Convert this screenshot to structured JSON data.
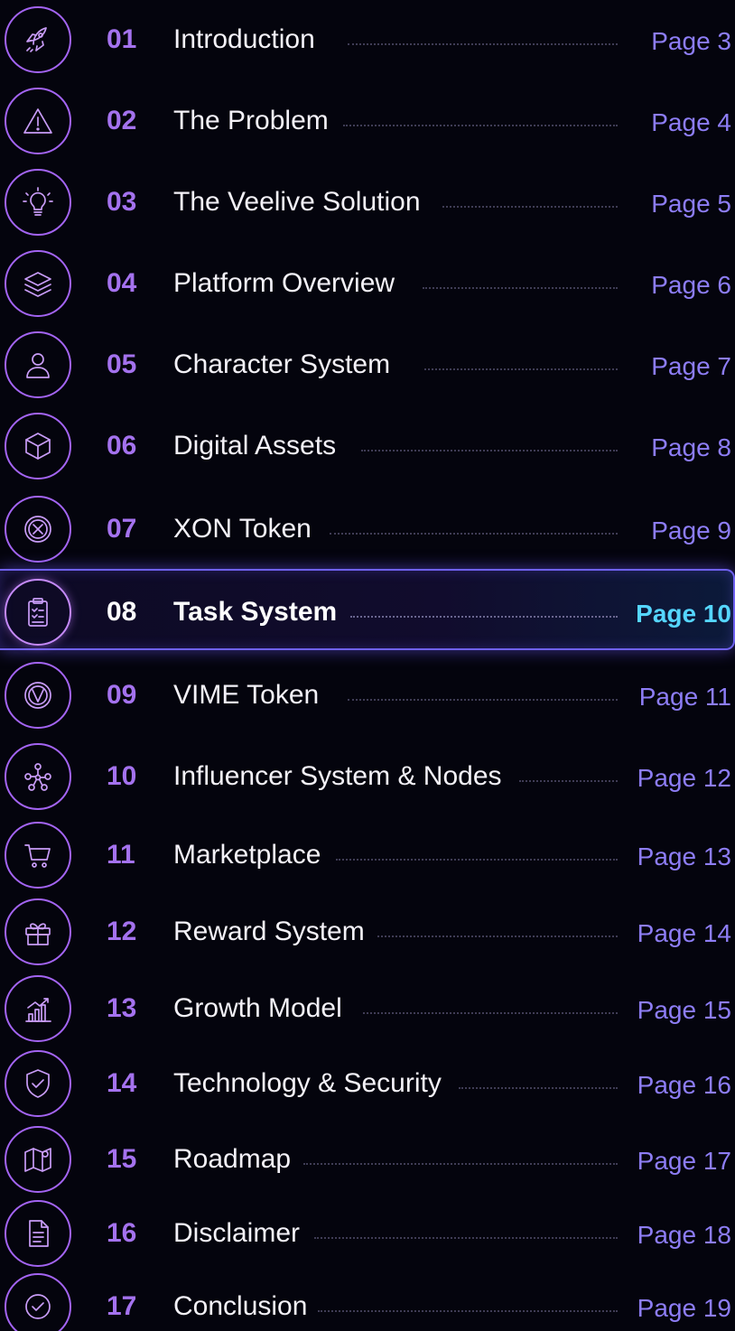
{
  "toc": {
    "items": [
      {
        "num": "01",
        "title": "Introduction",
        "page": "Page 3",
        "icon": "rocket-icon",
        "active": false
      },
      {
        "num": "02",
        "title": "The Problem",
        "page": "Page 4",
        "icon": "warning-icon",
        "active": false
      },
      {
        "num": "03",
        "title": "The Veelive Solution",
        "page": "Page 5",
        "icon": "lightbulb-icon",
        "active": false
      },
      {
        "num": "04",
        "title": "Platform Overview",
        "page": "Page 6",
        "icon": "layers-icon",
        "active": false
      },
      {
        "num": "05",
        "title": "Character System",
        "page": "Page 7",
        "icon": "user-icon",
        "active": false
      },
      {
        "num": "06",
        "title": "Digital Assets",
        "page": "Page 8",
        "icon": "cube-icon",
        "active": false
      },
      {
        "num": "07",
        "title": "XON Token",
        "page": "Page 9",
        "icon": "xon-coin-icon",
        "active": false
      },
      {
        "num": "08",
        "title": "Task System",
        "page": "Page 10",
        "icon": "clipboard-icon",
        "active": true
      },
      {
        "num": "09",
        "title": "VIME Token",
        "page": "Page 11",
        "icon": "vime-coin-icon",
        "active": false
      },
      {
        "num": "10",
        "title": "Influencer System & Nodes",
        "page": "Page 12",
        "icon": "network-icon",
        "active": false
      },
      {
        "num": "11",
        "title": "Marketplace",
        "page": "Page 13",
        "icon": "cart-icon",
        "active": false
      },
      {
        "num": "12",
        "title": "Reward System",
        "page": "Page 14",
        "icon": "gift-icon",
        "active": false
      },
      {
        "num": "13",
        "title": "Growth Model",
        "page": "Page 15",
        "icon": "growth-chart-icon",
        "active": false
      },
      {
        "num": "14",
        "title": "Technology & Security",
        "page": "Page 16",
        "icon": "shield-icon",
        "active": false
      },
      {
        "num": "15",
        "title": "Roadmap",
        "page": "Page 17",
        "icon": "map-icon",
        "active": false
      },
      {
        "num": "16",
        "title": "Disclaimer",
        "page": "Page 18",
        "icon": "document-icon",
        "active": false
      },
      {
        "num": "17",
        "title": "Conclusion",
        "page": "Page 19",
        "icon": "check-circle-icon",
        "active": false
      }
    ]
  },
  "colors": {
    "background": "#04040d",
    "accent_purple": "#a472ee",
    "page_link": "#8d7df5",
    "active_page": "#55d6ff"
  }
}
